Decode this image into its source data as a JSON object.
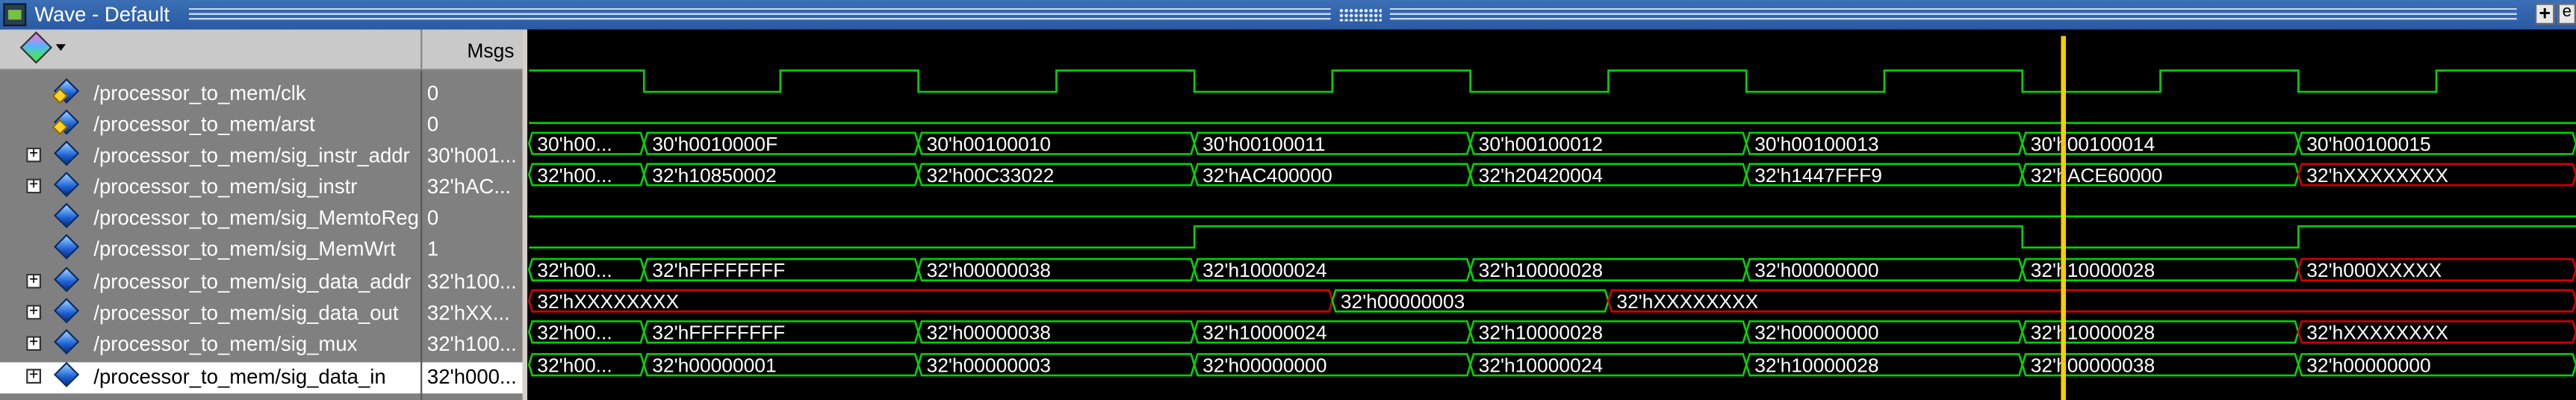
{
  "window": {
    "title": "Wave - Default",
    "buttons": [
      "+",
      "e"
    ]
  },
  "header": {
    "msgs_label": "Msgs"
  },
  "colors": {
    "wave_green": "#00d400",
    "wave_red": "#d00000",
    "cursor": "#ffcc00",
    "panel_gray": "#808080",
    "title_blue": "#2a5aa3"
  },
  "signals": [
    {
      "name": "/processor_to_mem/clk",
      "value": "0",
      "icon": "clock-signal-icon",
      "expandable": false
    },
    {
      "name": "/processor_to_mem/arst",
      "value": "0",
      "icon": "signal-input-icon",
      "expandable": false
    },
    {
      "name": "/processor_to_mem/sig_instr_addr",
      "value": "30'h001...",
      "icon": "signal-bus-icon",
      "expandable": true
    },
    {
      "name": "/processor_to_mem/sig_instr",
      "value": "32'hAC...",
      "icon": "signal-bus-icon",
      "expandable": true
    },
    {
      "name": "/processor_to_mem/sig_MemtoReg",
      "value": "0",
      "icon": "signal-icon",
      "expandable": false
    },
    {
      "name": "/processor_to_mem/sig_MemWrt",
      "value": "1",
      "icon": "signal-icon",
      "expandable": false
    },
    {
      "name": "/processor_to_mem/sig_data_addr",
      "value": "32'h100...",
      "icon": "signal-bus-icon",
      "expandable": true
    },
    {
      "name": "/processor_to_mem/sig_data_out",
      "value": "32'hXX...",
      "icon": "signal-bus-icon",
      "expandable": true
    },
    {
      "name": "/processor_to_mem/sig_mux",
      "value": "32'h100...",
      "icon": "signal-bus-icon",
      "expandable": true
    },
    {
      "name": "/processor_to_mem/sig_data_in",
      "value": "32'h000...",
      "icon": "signal-bus-icon",
      "expandable": true,
      "selected": true
    }
  ],
  "waves": {
    "edges": [
      392,
      475,
      559,
      643,
      727,
      811,
      895,
      979,
      1063,
      1147,
      1231,
      1315,
      1399,
      1483
    ],
    "cursor_time": 1256,
    "buses": {
      "sig_instr_addr": [
        {
          "t0": 322,
          "t1": 392,
          "label": "30'h00...",
          "x": false
        },
        {
          "t0": 392,
          "t1": 559,
          "label": "30'h0010000F",
          "x": false
        },
        {
          "t0": 559,
          "t1": 727,
          "label": "30'h00100010",
          "x": false
        },
        {
          "t0": 727,
          "t1": 895,
          "label": "30'h00100011",
          "x": false
        },
        {
          "t0": 895,
          "t1": 1063,
          "label": "30'h00100012",
          "x": false
        },
        {
          "t0": 1063,
          "t1": 1231,
          "label": "30'h00100013",
          "x": false
        },
        {
          "t0": 1231,
          "t1": 1399,
          "label": "30'h00100014",
          "x": false
        },
        {
          "t0": 1399,
          "t1": 1568,
          "label": "30'h00100015",
          "x": false
        }
      ],
      "sig_instr": [
        {
          "t0": 322,
          "t1": 392,
          "label": "32'h00...",
          "x": false
        },
        {
          "t0": 392,
          "t1": 559,
          "label": "32'h10850002",
          "x": false
        },
        {
          "t0": 559,
          "t1": 727,
          "label": "32'h00C33022",
          "x": false
        },
        {
          "t0": 727,
          "t1": 895,
          "label": "32'hAC400000",
          "x": false
        },
        {
          "t0": 895,
          "t1": 1063,
          "label": "32'h20420004",
          "x": false
        },
        {
          "t0": 1063,
          "t1": 1231,
          "label": "32'h1447FFF9",
          "x": false
        },
        {
          "t0": 1231,
          "t1": 1399,
          "label": "32'hACE60000",
          "x": false
        },
        {
          "t0": 1399,
          "t1": 1568,
          "label": "32'hXXXXXXXX",
          "x": true
        }
      ],
      "sig_data_addr": [
        {
          "t0": 322,
          "t1": 392,
          "label": "32'h00...",
          "x": false
        },
        {
          "t0": 392,
          "t1": 559,
          "label": "32'hFFFFFFFF",
          "x": false
        },
        {
          "t0": 559,
          "t1": 727,
          "label": "32'h00000038",
          "x": false
        },
        {
          "t0": 727,
          "t1": 895,
          "label": "32'h10000024",
          "x": false
        },
        {
          "t0": 895,
          "t1": 1063,
          "label": "32'h10000028",
          "x": false
        },
        {
          "t0": 1063,
          "t1": 1231,
          "label": "32'h00000000",
          "x": false
        },
        {
          "t0": 1231,
          "t1": 1399,
          "label": "32'h10000028",
          "x": false
        },
        {
          "t0": 1399,
          "t1": 1568,
          "label": "32'h000XXXXX",
          "x": true
        }
      ],
      "sig_data_out": [
        {
          "t0": 322,
          "t1": 811,
          "label": "32'hXXXXXXXX",
          "x": true
        },
        {
          "t0": 811,
          "t1": 979,
          "label": "32'h00000003",
          "x": false
        },
        {
          "t0": 979,
          "t1": 1568,
          "label": "32'hXXXXXXXX",
          "x": true
        }
      ],
      "sig_mux": [
        {
          "t0": 322,
          "t1": 392,
          "label": "32'h00...",
          "x": false
        },
        {
          "t0": 392,
          "t1": 559,
          "label": "32'hFFFFFFFF",
          "x": false
        },
        {
          "t0": 559,
          "t1": 727,
          "label": "32'h00000038",
          "x": false
        },
        {
          "t0": 727,
          "t1": 895,
          "label": "32'h10000024",
          "x": false
        },
        {
          "t0": 895,
          "t1": 1063,
          "label": "32'h10000028",
          "x": false
        },
        {
          "t0": 1063,
          "t1": 1231,
          "label": "32'h00000000",
          "x": false
        },
        {
          "t0": 1231,
          "t1": 1399,
          "label": "32'h10000028",
          "x": false
        },
        {
          "t0": 1399,
          "t1": 1568,
          "label": "32'hXXXXXXXX",
          "x": true
        }
      ],
      "sig_data_in": [
        {
          "t0": 322,
          "t1": 392,
          "label": "32'h00...",
          "x": false
        },
        {
          "t0": 392,
          "t1": 559,
          "label": "32'h00000001",
          "x": false
        },
        {
          "t0": 559,
          "t1": 727,
          "label": "32'h00000003",
          "x": false
        },
        {
          "t0": 727,
          "t1": 895,
          "label": "32'h00000000",
          "x": false
        },
        {
          "t0": 895,
          "t1": 1063,
          "label": "32'h10000024",
          "x": false
        },
        {
          "t0": 1063,
          "t1": 1231,
          "label": "32'h10000028",
          "x": false
        },
        {
          "t0": 1231,
          "t1": 1399,
          "label": "32'h00000038",
          "x": false
        },
        {
          "t0": 1399,
          "t1": 1568,
          "label": "32'h00000000",
          "x": false
        }
      ]
    },
    "arst_level": 0,
    "memtoreg": [
      {
        "t0": 322,
        "t1": 1568,
        "level": 0
      }
    ],
    "memwrt": [
      {
        "t0": 322,
        "t1": 727,
        "level": 0
      },
      {
        "t0": 727,
        "t1": 1231,
        "level": 1
      },
      {
        "t0": 1231,
        "t1": 1399,
        "level": 0
      },
      {
        "t0": 1399,
        "t1": 1568,
        "level": 1
      }
    ]
  }
}
